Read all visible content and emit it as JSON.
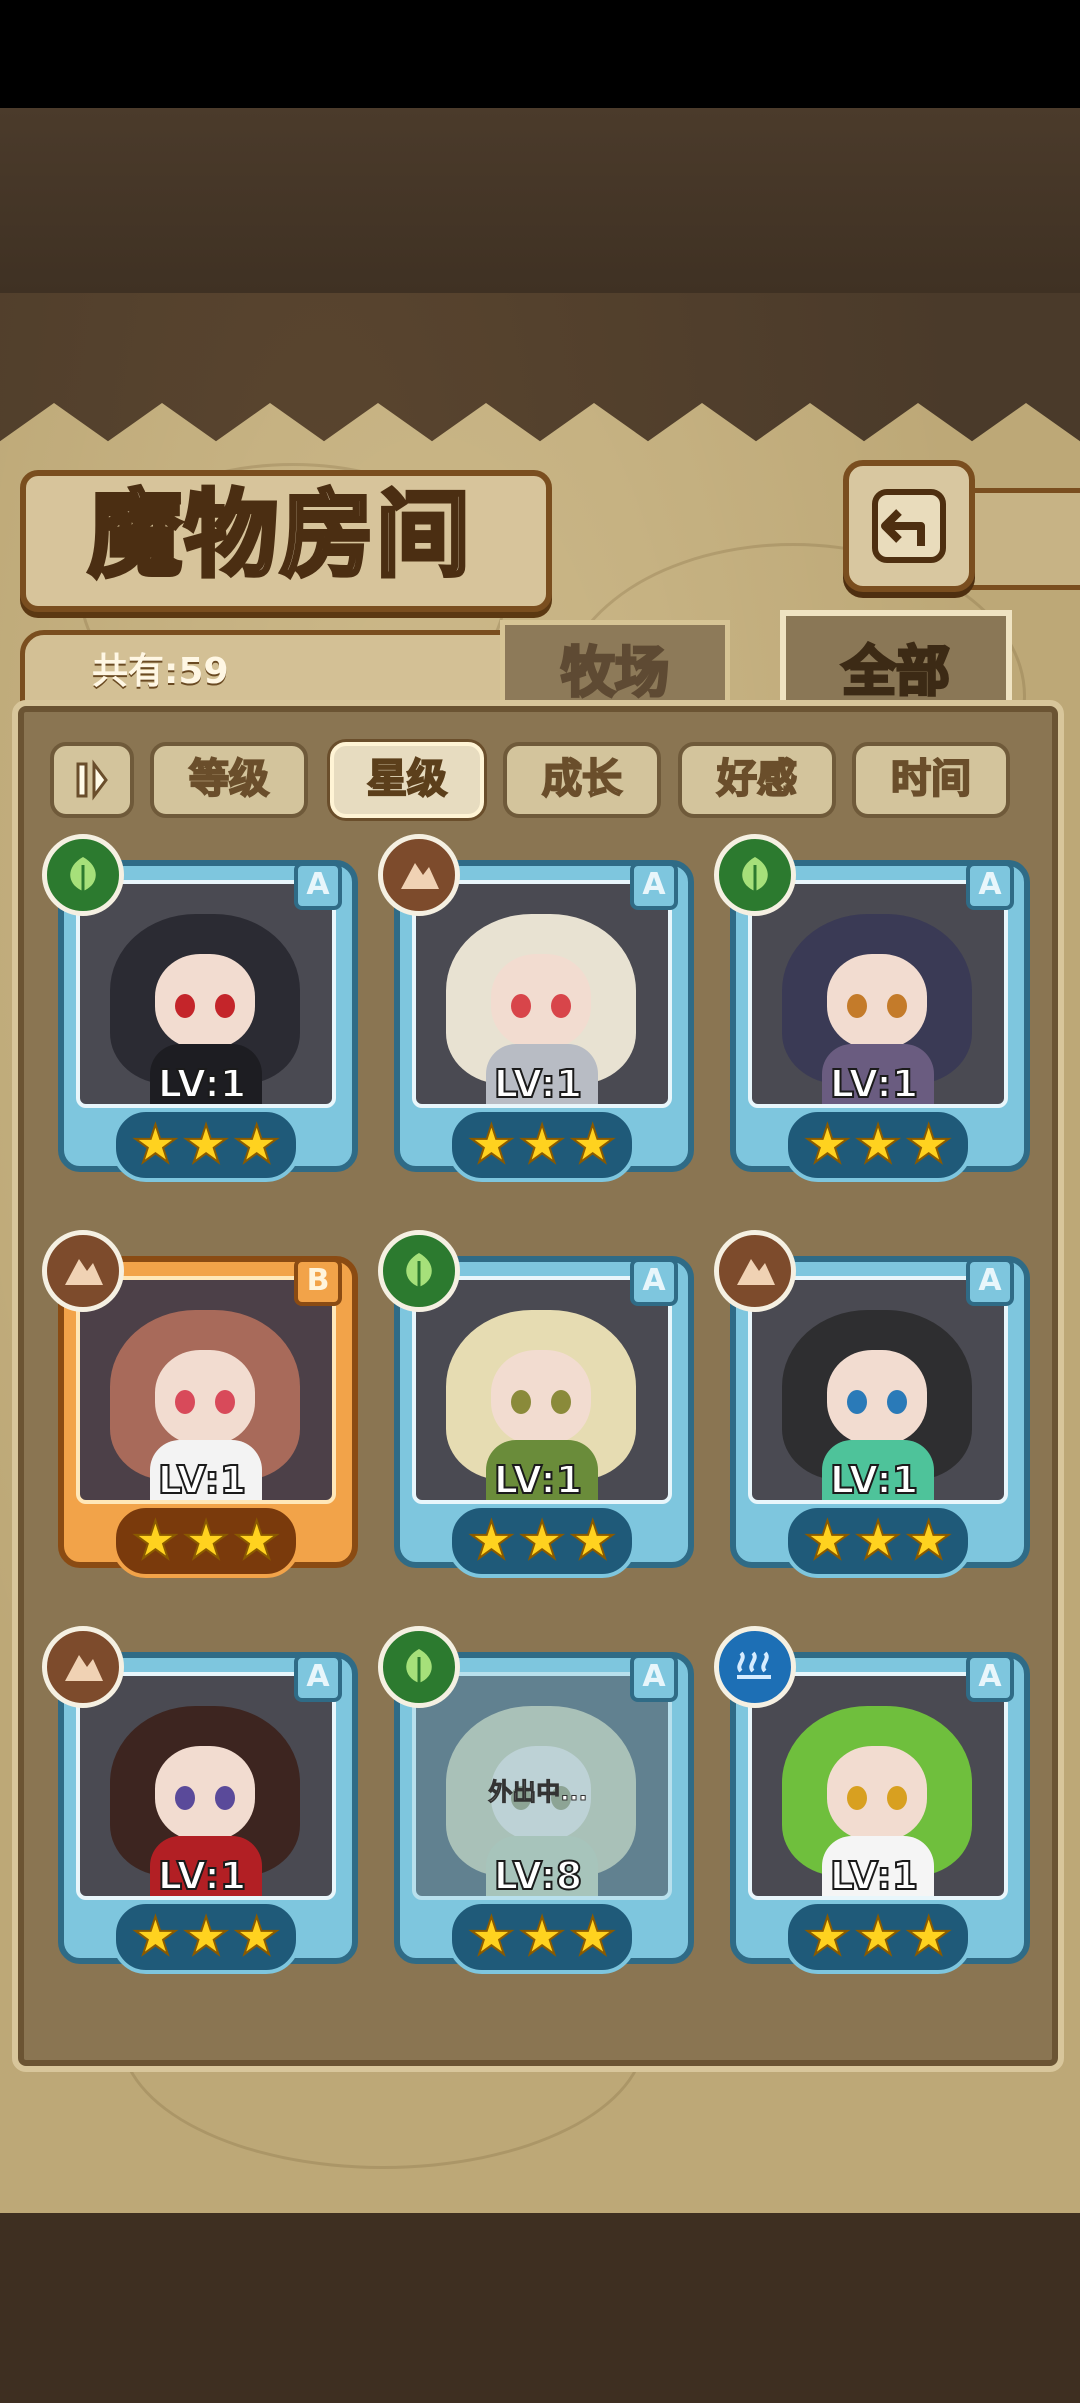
{
  "header": {
    "title": "魔物房间",
    "back_icon": "return-arrow-icon"
  },
  "summary": {
    "count_label": "共有:59"
  },
  "tabs": [
    {
      "label": "牧场",
      "active": false
    },
    {
      "label": "全部",
      "active": true
    }
  ],
  "filters": {
    "sort_toggle_icon": "sort-order-icon",
    "buttons": [
      {
        "label": "等级",
        "active": false
      },
      {
        "label": "星级",
        "active": true
      },
      {
        "label": "成长",
        "active": false
      },
      {
        "label": "好感",
        "active": false
      },
      {
        "label": "时间",
        "active": false
      }
    ]
  },
  "monsters": [
    {
      "element": "leaf",
      "rank": "A",
      "level": "LV:1",
      "stars": 3,
      "status": ""
    },
    {
      "element": "rock",
      "rank": "A",
      "level": "LV:1",
      "stars": 3,
      "status": ""
    },
    {
      "element": "leaf",
      "rank": "A",
      "level": "LV:1",
      "stars": 3,
      "status": ""
    },
    {
      "element": "rock",
      "rank": "B",
      "level": "LV:1",
      "stars": 3,
      "status": ""
    },
    {
      "element": "leaf",
      "rank": "A",
      "level": "LV:1",
      "stars": 3,
      "status": ""
    },
    {
      "element": "rock",
      "rank": "A",
      "level": "LV:1",
      "stars": 3,
      "status": ""
    },
    {
      "element": "rock",
      "rank": "A",
      "level": "LV:1",
      "stars": 3,
      "status": ""
    },
    {
      "element": "leaf",
      "rank": "A",
      "level": "LV:8",
      "stars": 3,
      "status": "外出中..."
    },
    {
      "element": "water",
      "rank": "A",
      "level": "LV:1",
      "stars": 3,
      "status": ""
    }
  ],
  "colors": {
    "rank_a_frame": "#7ec6de",
    "rank_b_frame": "#f2a349",
    "star": "#ffd21f",
    "element_leaf": "#2c7a2f",
    "element_rock": "#7d4b2c",
    "element_water": "#1d6fb5"
  }
}
